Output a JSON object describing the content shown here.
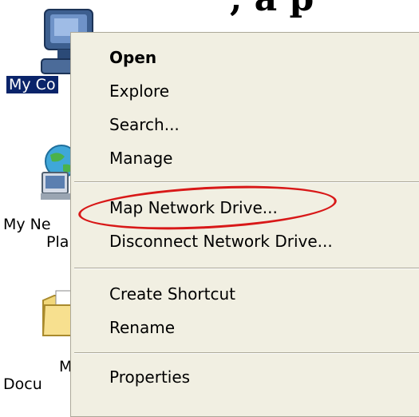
{
  "heading": {
    "visible_text": ", a   p"
  },
  "desktop": {
    "icons": [
      {
        "icon": "my-computer-icon",
        "label": "My Co"
      },
      {
        "icon": "my-network-places-icon",
        "label_line1": "My Ne",
        "label_line2": "Pla"
      },
      {
        "icon": "my-documents-icon",
        "label_line1": "M",
        "label_line2": "Docu"
      }
    ]
  },
  "context_menu": {
    "items": [
      {
        "label": "Open",
        "default": true
      },
      {
        "label": "Explore"
      },
      {
        "label": "Search..."
      },
      {
        "label": "Manage"
      },
      {
        "label": "Map Network Drive...",
        "highlighted": true
      },
      {
        "label": "Disconnect Network Drive..."
      },
      {
        "label": "Create Shortcut"
      },
      {
        "label": "Rename"
      },
      {
        "label": "Properties"
      }
    ]
  },
  "colors": {
    "menu_background": "#f1efe2",
    "selection_background": "#0a246a",
    "annotation_red": "#d81818"
  }
}
